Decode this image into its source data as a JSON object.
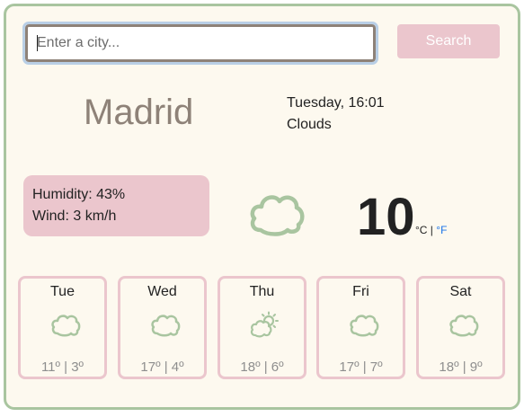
{
  "search": {
    "placeholder": "Enter a city...",
    "button_label": "Search"
  },
  "current": {
    "city": "Madrid",
    "datetime": "Tuesday, 16:01",
    "description": "Clouds",
    "humidity": "Humidity: 43%",
    "wind": "Wind: 3 km/h",
    "temperature": "10",
    "unit_c": "°C",
    "unit_sep": " | ",
    "unit_f": "°F",
    "icon": "cloud-icon"
  },
  "forecast": [
    {
      "day": "Tue",
      "temps": "11º | 3º",
      "icon": "cloud-icon"
    },
    {
      "day": "Wed",
      "temps": "17º | 4º",
      "icon": "cloud-icon"
    },
    {
      "day": "Thu",
      "temps": "18º | 6º",
      "icon": "sun-cloud-icon"
    },
    {
      "day": "Fri",
      "temps": "17º | 7º",
      "icon": "cloud-icon"
    },
    {
      "day": "Sat",
      "temps": "18º | 9º",
      "icon": "cloud-icon"
    }
  ],
  "colors": {
    "accent": "#ebc6cd",
    "border": "#a9c5a0",
    "background": "#fdf9ef",
    "link": "#1a73e8"
  }
}
